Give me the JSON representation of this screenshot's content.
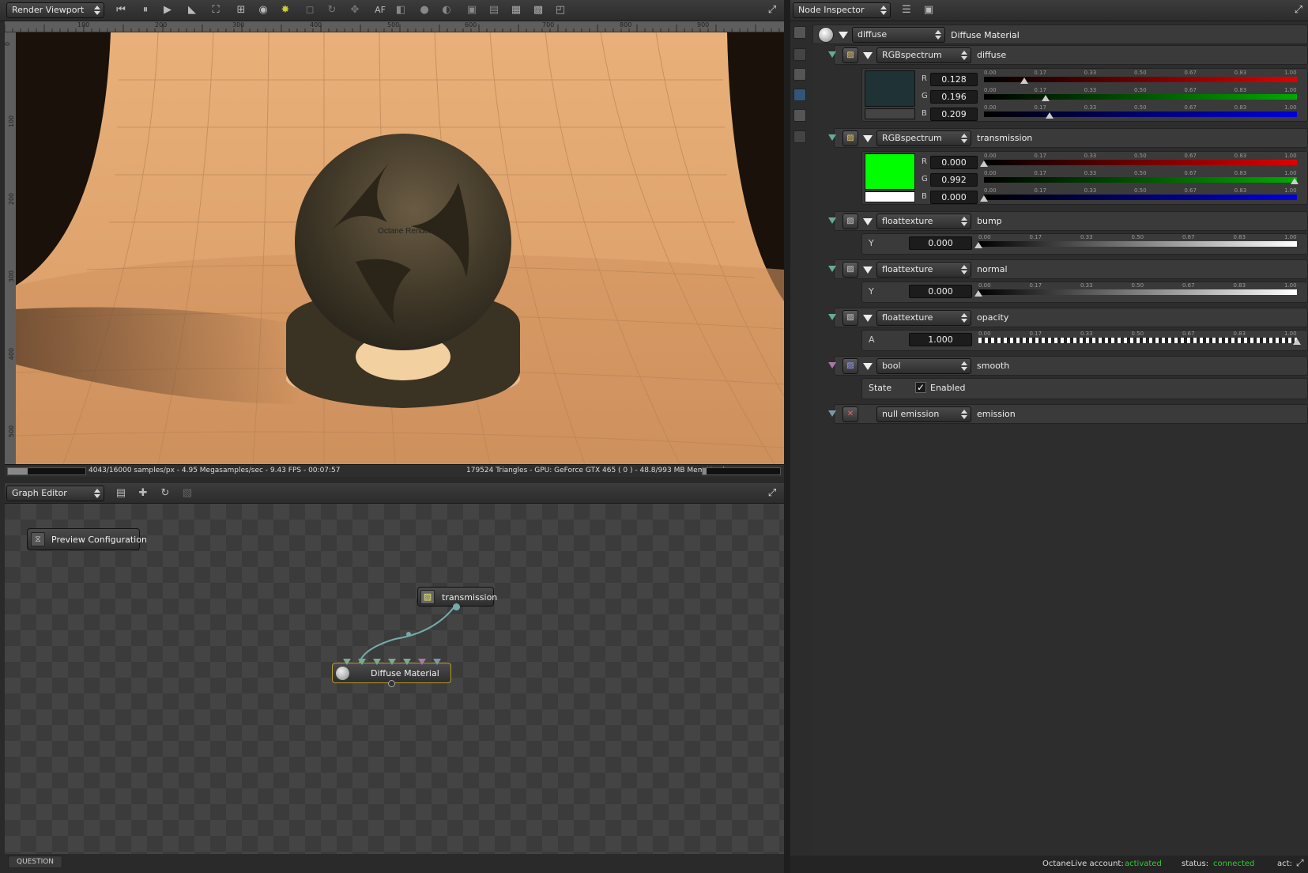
{
  "viewport": {
    "dropdown": "Render Viewport",
    "af_label": "AF",
    "ruler_ticks": [
      "100",
      "200",
      "300",
      "400",
      "500",
      "600",
      "700",
      "800",
      "900"
    ],
    "vruler_ticks": [
      "0",
      "100",
      "200",
      "300",
      "400",
      "500"
    ],
    "sphere_logo_text": "Octane Render",
    "status_left": "4043/16000 samples/px - 4.95 Megasamples/sec - 9.43 FPS - 00:07:57",
    "status_right": "179524 Triangles - GPU: GeForce GTX 465 ( 0 ) - 48.8/993 MB Mem Used",
    "progress": 0.25
  },
  "graph": {
    "dropdown": "Graph Editor",
    "nodes": {
      "preview": "Preview Configuration",
      "transmission": "transmission",
      "material": "Diffuse Material"
    },
    "footer": "QUESTION"
  },
  "inspector": {
    "dropdown": "Node Inspector",
    "material_type": "diffuse",
    "material_name": "Diffuse Material",
    "tick_labels": [
      "0.00",
      "0.17",
      "0.33",
      "0.50",
      "0.67",
      "0.83",
      "1.00"
    ],
    "diffuse": {
      "type": "RGBspectrum",
      "name": "diffuse",
      "r": "0.128",
      "g": "0.196",
      "b": "0.209",
      "swatch": "#1f3235"
    },
    "transmission": {
      "type": "RGBspectrum",
      "name": "transmission",
      "r": "0.000",
      "g": "0.992",
      "b": "0.000",
      "swatch": "#00fd00"
    },
    "bump": {
      "type": "floattexture",
      "name": "bump",
      "ch": "Y",
      "value": "0.000"
    },
    "normal": {
      "type": "floattexture",
      "name": "normal",
      "ch": "Y",
      "value": "0.000"
    },
    "opacity": {
      "type": "floattexture",
      "name": "opacity",
      "ch": "A",
      "value": "1.000"
    },
    "smooth": {
      "type": "bool",
      "name": "smooth",
      "state_label": "State",
      "enabled_label": "Enabled",
      "checked": true
    },
    "emission": {
      "type": "null emission",
      "name": "emission"
    },
    "ch_r": "R",
    "ch_g": "G",
    "ch_b": "B"
  },
  "statusbar": {
    "account_label": "OctaneLive account:",
    "account_value": "activated",
    "status_label": "status:",
    "status_value": "connected",
    "act_label": "act:"
  },
  "colors": {
    "accent_green": "#33cc33",
    "red": "#cc0000",
    "green": "#00aa00",
    "blue": "#0000dd"
  }
}
